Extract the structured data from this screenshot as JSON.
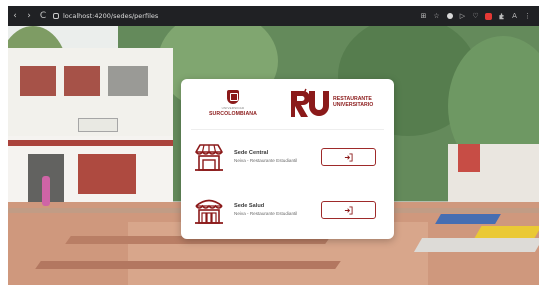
{
  "browser": {
    "url": "localhost:4200/sedes/perfiles",
    "back_glyph": "‹",
    "forward_glyph": "›",
    "reload_glyph": "C",
    "toolbar_glyphs": [
      "⊞",
      "☆",
      "▷",
      "♡",
      "A",
      "⋮"
    ]
  },
  "card": {
    "logos": {
      "university_small": "UNIVERSIDAD",
      "university_name": "SURCOLOMBIANA",
      "restaurant_mark": "RU",
      "restaurant_line1": "RESTAURANTE",
      "restaurant_line2": "UNIVERSITARIO"
    },
    "sites": [
      {
        "name": "Sede Central",
        "subtitle": "Neiva - Restaurante Estudiantil",
        "icon": "storefront-awning-icon"
      },
      {
        "name": "Sede Salud",
        "subtitle": "Neiva - Restaurante Estudiantil",
        "icon": "storefront-building-icon"
      }
    ],
    "enter_icon": "login-arrow-icon"
  },
  "colors": {
    "brand": "#8b1a1a",
    "browser_bar": "#202124",
    "card_bg": "#ffffff"
  }
}
